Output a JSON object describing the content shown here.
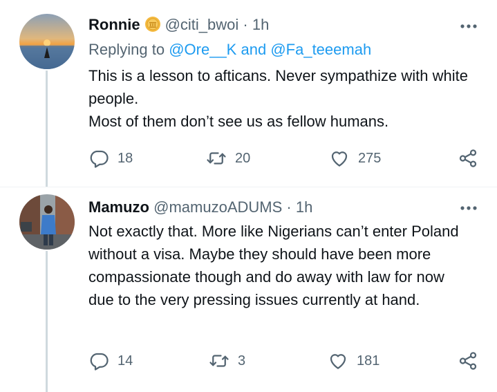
{
  "tweets": [
    {
      "display_name": "Ronnie",
      "handle": "@citi_bwoi",
      "dot": "·",
      "time": "1h",
      "reply_prefix": "Replying to",
      "reply_mention_1": "@Ore__K",
      "reply_and": "and",
      "reply_mention_2": "@Fa_teeemah",
      "text_line_1": "This is a lesson to afticans. Never sympathize with white people.",
      "text_line_2": "Most of them don’t see us as fellow humans.",
      "replies": "18",
      "retweets": "20",
      "likes": "275",
      "avatar_icon": "sunset-sea-avatar",
      "badge_icon": "gold-coin-badge-icon"
    },
    {
      "display_name": "Mamuzo",
      "handle": "@mamuzoADUMS",
      "dot": "·",
      "time": "1h",
      "text": "Not exactly that. More like Nigerians can’t enter Poland without a visa. Maybe they should have been more compassionate though and do away with law for now due to the very pressing issues currently at hand.",
      "replies": "14",
      "retweets": "3",
      "likes": "181",
      "avatar_icon": "person-street-avatar"
    }
  ],
  "colors": {
    "text": "#0f1419",
    "secondary": "#536471",
    "link": "#1d9bf0",
    "thread_line": "#cfd9de",
    "badge": "#f4b93e"
  }
}
